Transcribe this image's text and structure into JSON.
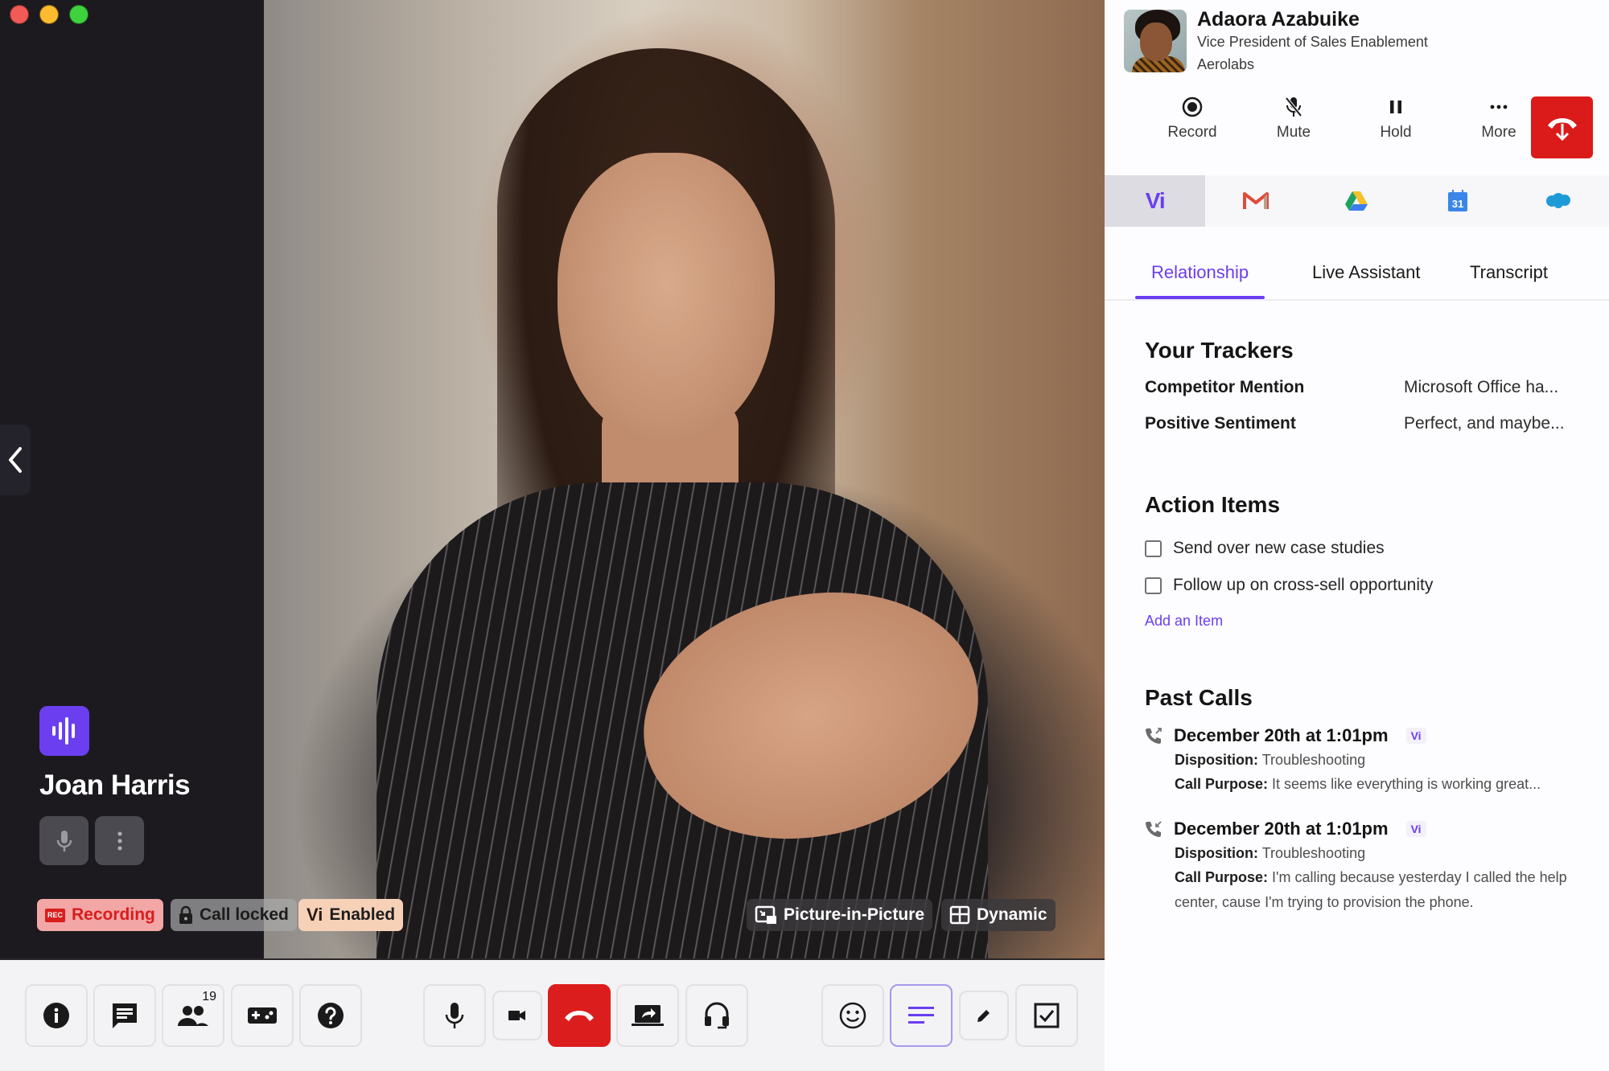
{
  "window": {
    "controls": [
      "close",
      "minimize",
      "maximize"
    ]
  },
  "speaker": {
    "name": "Joan Harris",
    "badge_icon": "audio-wave-icon"
  },
  "status_tags": {
    "recording": "Recording",
    "recording_icon_text": "REC",
    "call_locked": "Call locked",
    "vi_enabled": "Enabled",
    "vi_mark": "Vi"
  },
  "view_tags": {
    "pip": "Picture-in-Picture",
    "dynamic": "Dynamic"
  },
  "toolbar": {
    "participants_count": "19",
    "buttons": [
      "info",
      "chat",
      "participants",
      "apps",
      "help",
      "microphone",
      "camera",
      "end-call",
      "share-screen",
      "headset",
      "reactions",
      "notes",
      "annotate",
      "tasks"
    ],
    "active": "notes"
  },
  "contact": {
    "name": "Adaora Azabuike",
    "title": "Vice President of Sales Enablement",
    "company": "Aerolabs"
  },
  "call_actions": {
    "record": "Record",
    "mute": "Mute",
    "hold": "Hold",
    "more": "More"
  },
  "integrations": {
    "items": [
      "Vi",
      "Gmail",
      "Google Drive",
      "Google Calendar",
      "Salesforce"
    ],
    "calendar_day": "31",
    "active": "Vi"
  },
  "tabs": {
    "items": [
      "Relationship",
      "Live Assistant",
      "Transcript"
    ],
    "active": "Relationship"
  },
  "trackers": {
    "title": "Your Trackers",
    "rows": [
      {
        "name": "Competitor Mention",
        "value": "Microsoft Office ha..."
      },
      {
        "name": "Positive Sentiment",
        "value": "Perfect, and maybe..."
      }
    ]
  },
  "action_items": {
    "title": "Action Items",
    "items": [
      {
        "label": "Send over new case studies",
        "checked": false
      },
      {
        "label": "Follow up on cross-sell opportunity",
        "checked": false
      }
    ],
    "add_label": "Add an Item"
  },
  "past_calls": {
    "title": "Past Calls",
    "disposition_label": "Disposition:",
    "purpose_label": "Call Purpose:",
    "calls": [
      {
        "direction": "outgoing",
        "date": "December 20th at 1:01pm",
        "tag": "Vi",
        "disposition": "Troubleshooting",
        "purpose": "It seems like everything is working great..."
      },
      {
        "direction": "incoming",
        "date": "December 20th at 1:01pm",
        "tag": "Vi",
        "disposition": "Troubleshooting",
        "purpose": "I'm calling because yesterday I called the help center, cause I'm trying to provision the phone."
      }
    ]
  },
  "colors": {
    "accent": "#6a3ef0",
    "danger": "#db1a1a",
    "recording_bg": "#f3a6a6",
    "vi_tag_bg": "#f6d1b8"
  }
}
